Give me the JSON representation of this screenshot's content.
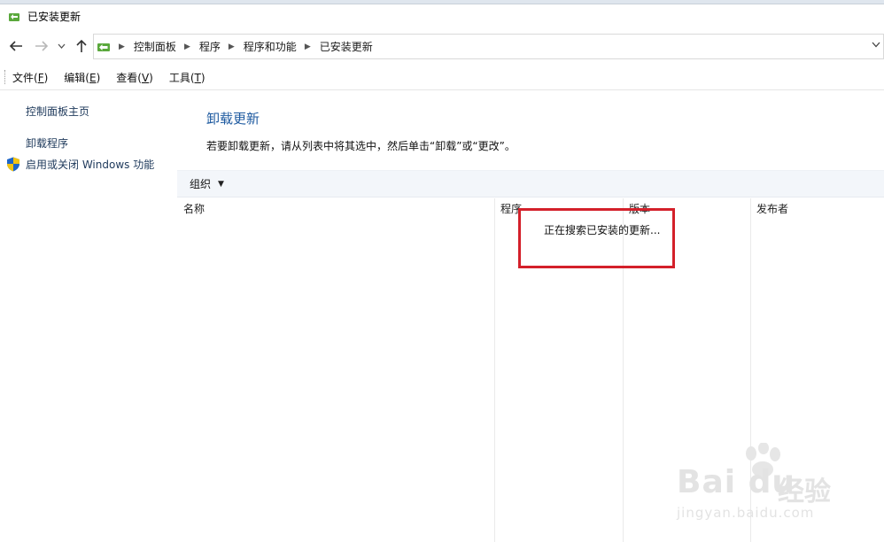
{
  "window": {
    "title": "已安装更新",
    "app_icon": "control-panel-icon"
  },
  "nav": {
    "back_icon": "arrow-left-icon",
    "forward_icon": "arrow-right-icon",
    "recent_icon": "chevron-down-icon",
    "up_icon": "arrow-up-icon",
    "breadcrumbs": [
      "控制面板",
      "程序",
      "程序和功能",
      "已安装更新"
    ]
  },
  "menu": {
    "items": [
      {
        "label": "文件(",
        "key": "F",
        "tail": ")"
      },
      {
        "label": "编辑(",
        "key": "E",
        "tail": ")"
      },
      {
        "label": "查看(",
        "key": "V",
        "tail": ")"
      },
      {
        "label": "工具(",
        "key": "T",
        "tail": ")"
      }
    ]
  },
  "sidebar": {
    "home_link": "控制面板主页",
    "uninstall_link": "卸载程序",
    "features_link": "启用或关闭 Windows 功能",
    "features_icon": "uac-shield-icon"
  },
  "main": {
    "title": "卸载更新",
    "description": "若要卸载更新，请从列表中将其选中，然后单击“卸载”或“更改”。",
    "organize_label": "组织",
    "columns": [
      "名称",
      "程序",
      "版本",
      "发布者"
    ],
    "status_text": "正在搜索已安装的更新..."
  },
  "colors": {
    "link": "#1e395b",
    "heading": "#1e5aa0",
    "command_bar": "#f3f6fa",
    "highlight_box": "#d4202a"
  },
  "watermark": {
    "brand": "Bai du",
    "brand_cn": "经验",
    "url": "jingyan.baidu.com"
  }
}
